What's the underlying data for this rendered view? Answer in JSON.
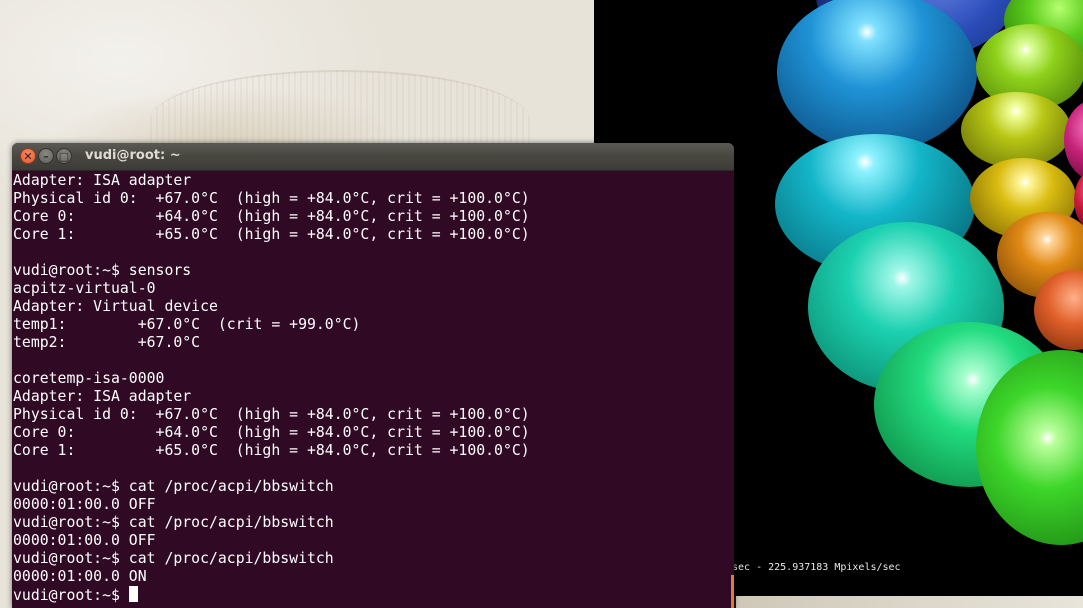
{
  "terminal": {
    "title": "vudi@root: ~",
    "buttons": {
      "close_glyph": "✕",
      "minimize_glyph": "–",
      "maximize_glyph": "▢"
    },
    "lines": [
      "Adapter: ISA adapter",
      "Physical id 0:  +67.0°C  (high = +84.0°C, crit = +100.0°C)",
      "Core 0:         +64.0°C  (high = +84.0°C, crit = +100.0°C)",
      "Core 1:         +65.0°C  (high = +84.0°C, crit = +100.0°C)",
      "",
      "vudi@root:~$ sensors",
      "acpitz-virtual-0",
      "Adapter: Virtual device",
      "temp1:        +67.0°C  (crit = +99.0°C)",
      "temp2:        +67.0°C",
      "",
      "coretemp-isa-0000",
      "Adapter: ISA adapter",
      "Physical id 0:  +67.0°C  (high = +84.0°C, crit = +100.0°C)",
      "Core 0:         +64.0°C  (high = +84.0°C, crit = +100.0°C)",
      "Core 1:         +65.0°C  (high = +84.0°C, crit = +100.0°C)",
      "",
      "vudi@root:~$ cat /proc/acpi/bbswitch",
      "0000:01:00.0 OFF",
      "vudi@root:~$ cat /proc/acpi/bbswitch",
      "0000:01:00.0 OFF",
      "vudi@root:~$ cat /proc/acpi/bbswitch",
      "0000:01:00.0 ON"
    ],
    "prompt": "vudi@root:~$ ",
    "colors": {
      "background": "#300a24",
      "foreground": "#ffffff",
      "titlebar": "#3c3b37"
    }
  },
  "gl_window": {
    "fps_text": "sec - 225.937183 Mpixels/sec",
    "background": "#000000"
  }
}
